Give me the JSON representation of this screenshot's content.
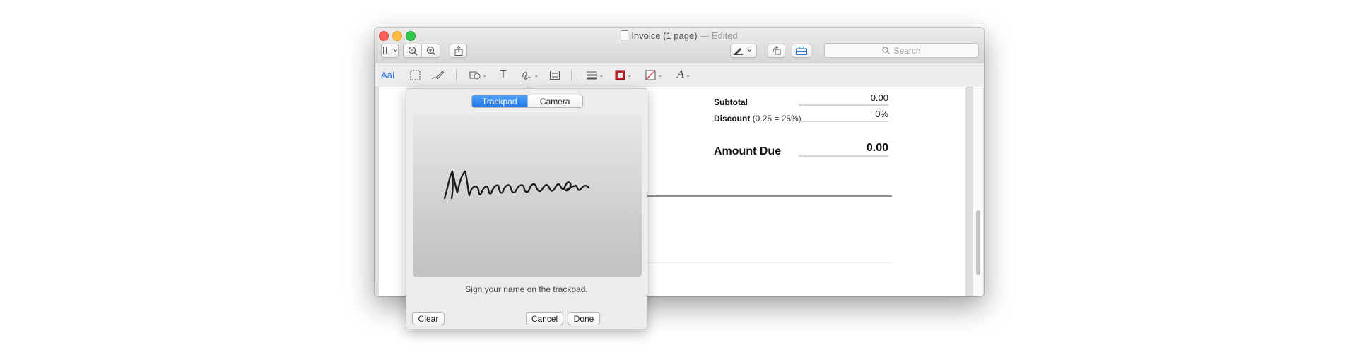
{
  "window": {
    "title": "Invoice (1 page)",
    "title_separator": "—",
    "status": "Edited"
  },
  "toolbar": {
    "search_placeholder": "Search",
    "buttons": [
      "sidebar-toggle",
      "zoom-out",
      "zoom-in",
      "share",
      "markup-pen",
      "rotate",
      "toolbox"
    ]
  },
  "markup_toolbar": {
    "text_selection_label": "AaI",
    "text_tool_label": "T",
    "font_tool_label": "A"
  },
  "invoice": {
    "subtotal_label": "Subtotal",
    "subtotal_value": "0.00",
    "discount_label": "Discount",
    "discount_note": "(0.25 = 25%)",
    "discount_value": "0%",
    "amount_due_label": "Amount Due",
    "amount_due_value": "0.00"
  },
  "signature_popover": {
    "tabs": [
      {
        "label": "Trackpad",
        "active": true
      },
      {
        "label": "Camera",
        "active": false
      }
    ],
    "signature_text": "Marrimora",
    "hint": "Sign your name on the trackpad.",
    "clear_label": "Clear",
    "cancel_label": "Cancel",
    "done_label": "Done"
  },
  "colors": {
    "accent": "#1f78e8",
    "close": "#fc615d",
    "minimize": "#fdbc40",
    "maximize": "#34c84a",
    "border_color_swatch": "#c0202a",
    "fill_color_swatch": "#ffffff"
  }
}
